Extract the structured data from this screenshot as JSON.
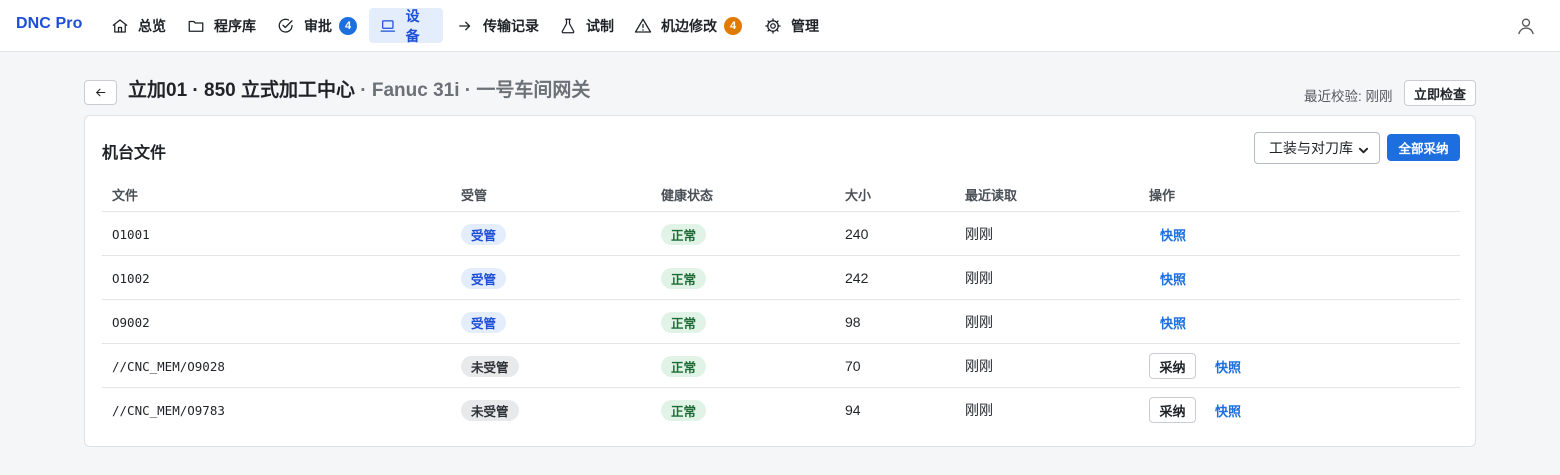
{
  "nav": {
    "brand": "DNC Pro",
    "items": [
      {
        "label": "总览",
        "icon": "home-icon"
      },
      {
        "label": "程序库",
        "icon": "folder-icon"
      },
      {
        "label": "审批",
        "icon": "check-circle-icon",
        "badge": "4",
        "badge_color": "#1d6fe0"
      },
      {
        "label": "设备",
        "icon": "laptop-icon",
        "active": true
      },
      {
        "label": "传输记录",
        "icon": "arrow-right-icon"
      },
      {
        "label": "试制",
        "icon": "flask-icon"
      },
      {
        "label": "机边修改",
        "icon": "warning-icon",
        "badge": "4",
        "badge_color": "#e07b00"
      },
      {
        "label": "管理",
        "icon": "gear-icon"
      }
    ],
    "user_icon": "user-icon"
  },
  "header": {
    "title_main": "立加01 · 850 立式加工中心",
    "title_sub": " · Fanuc 31i · 一号车间网关",
    "last_check": "最近校验: 刚刚",
    "check_now_label": "立即检查"
  },
  "card": {
    "title": "机台文件",
    "group_select_value": "工装与对刀库",
    "adopt_all_label": "全部采纳",
    "columns": [
      "文件",
      "受管",
      "健康状态",
      "大小",
      "最近读取",
      "操作"
    ],
    "rows": [
      {
        "file": "O1001",
        "managed": "受管",
        "managed_state": "managed",
        "health": "正常",
        "size": "240",
        "last_read": "刚刚",
        "actions": [
          "快照"
        ]
      },
      {
        "file": "O1002",
        "managed": "受管",
        "managed_state": "managed",
        "health": "正常",
        "size": "242",
        "last_read": "刚刚",
        "actions": [
          "快照"
        ]
      },
      {
        "file": "O9002",
        "managed": "受管",
        "managed_state": "managed",
        "health": "正常",
        "size": "98",
        "last_read": "刚刚",
        "actions": [
          "快照"
        ]
      },
      {
        "file": "//CNC_MEM/O9028",
        "managed": "未受管",
        "managed_state": "unmanaged",
        "health": "正常",
        "size": "70",
        "last_read": "刚刚",
        "actions": [
          "采纳",
          "快照"
        ]
      },
      {
        "file": "//CNC_MEM/O9783",
        "managed": "未受管",
        "managed_state": "unmanaged",
        "health": "正常",
        "size": "94",
        "last_read": "刚刚",
        "actions": [
          "采纳",
          "快照"
        ]
      }
    ]
  },
  "colors": {
    "accent": "#1d6fe0",
    "brand": "#1d4ed8",
    "warning_badge": "#e07b00",
    "ok_green": "#1c6b35"
  }
}
